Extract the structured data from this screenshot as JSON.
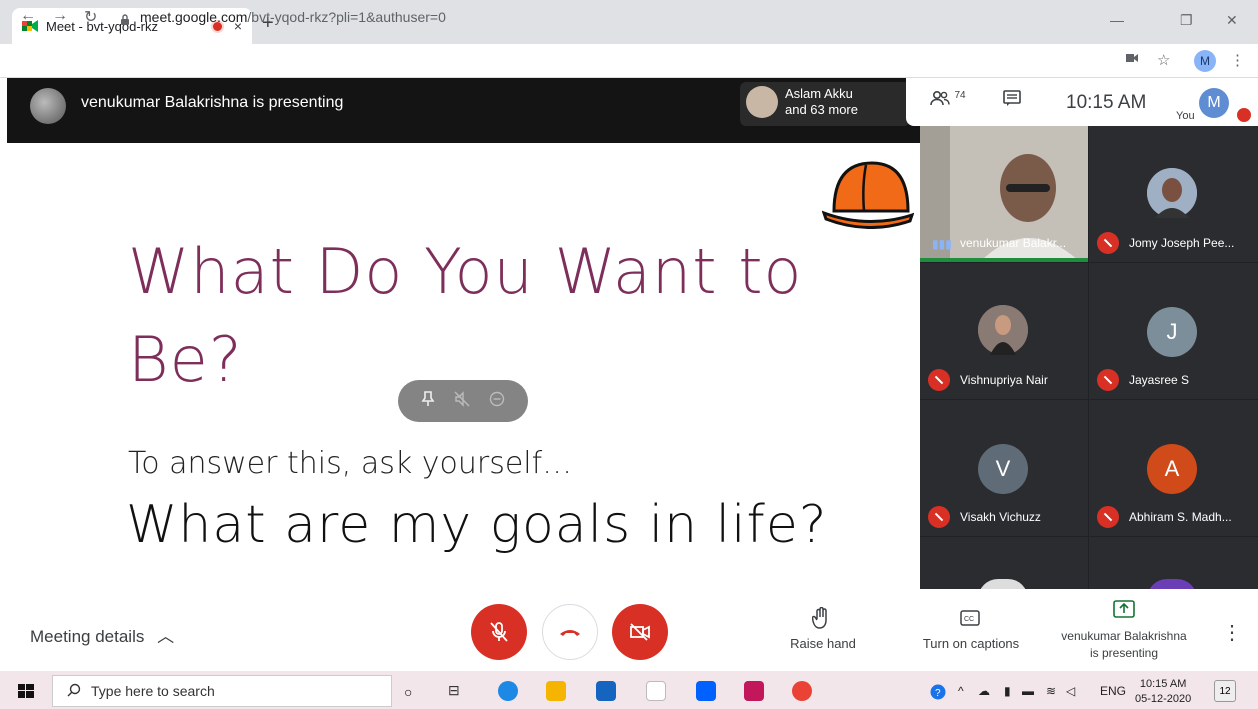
{
  "browser": {
    "tab_title": "Meet - bvt-yqod-rkz",
    "tab_close": "×",
    "new_tab": "+",
    "url_domain": "meet.google.com",
    "url_path": "/bvt-yqod-rkz?pli=1&authuser=0",
    "profile_initial": "M",
    "minimize": "—",
    "restore": "❐",
    "close": "✕"
  },
  "meet": {
    "presenting_banner": "venukumar Balakrishna is presenting",
    "others_name": "Aslam Akku",
    "others_more": "and 63 more",
    "people_count": "74",
    "time": "10:15 AM",
    "you_label": "You",
    "you_initial": "M"
  },
  "slide": {
    "title_line1": "What Do You Want to",
    "title_line2": "Be?",
    "subtitle": "To answer this, ask yourself…",
    "question": "What are my goals in life?"
  },
  "participants": [
    {
      "name": "venukumar Balakr...",
      "initial": "",
      "color": "#8d8a85"
    },
    {
      "name": "Jomy Joseph Pee...",
      "initial": "",
      "color": "#7a8ca3"
    },
    {
      "name": "Vishnupriya Nair",
      "initial": "",
      "color": "#6b5a57"
    },
    {
      "name": "Jayasree S",
      "initial": "J",
      "color": "#7b8e9a"
    },
    {
      "name": "Visakh Vichuzz",
      "initial": "V",
      "color": "#5f6b76"
    },
    {
      "name": "Abhiram S. Madh...",
      "initial": "A",
      "color": "#d04a1a"
    }
  ],
  "controls": {
    "meeting_details": "Meeting details",
    "raise_hand": "Raise hand",
    "captions": "Turn on captions",
    "presenting_line1": "venukumar Balakrishna",
    "presenting_line2": "is presenting"
  },
  "taskbar": {
    "search_placeholder": "Type here to search",
    "language": "ENG",
    "time": "10:15 AM",
    "date": "05-12-2020",
    "notifications": "12"
  },
  "colors": {
    "accent_red": "#d93025",
    "slide_title": "#7d2e5a"
  }
}
